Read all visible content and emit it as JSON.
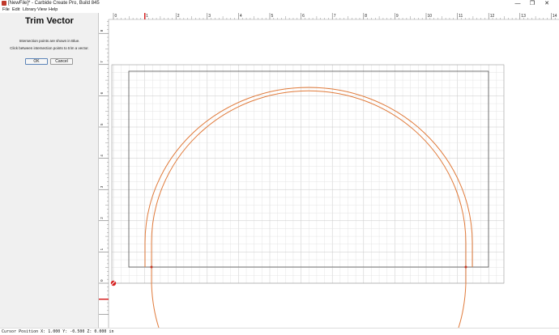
{
  "window": {
    "title": "[NewFile]* - Carbide Create Pro, Build 845",
    "minimize_glyph": "—",
    "maximize_glyph": "❐",
    "close_glyph": "✕"
  },
  "menu": [
    "File",
    "Edit",
    "Library",
    "View",
    "Help"
  ],
  "panel": {
    "title": "Trim Vector",
    "line1": "Intersection points are shown in Blue.",
    "line2": "Click between intersection points to trim a vector.",
    "ok_label": "OK",
    "cancel_label": "Cancel"
  },
  "ruler": {
    "x_ticks": [
      "0",
      "1",
      "2",
      "3",
      "4",
      "5",
      "6",
      "7",
      "8",
      "9",
      "10",
      "11",
      "12",
      "13",
      "14"
    ],
    "y_ticks": [
      "0",
      "1",
      "2",
      "3",
      "4",
      "5",
      "6",
      "7",
      "8"
    ]
  },
  "status": {
    "text": "Cursor Position X: 1.000 Y: -0.500 Z: 0.000 in"
  },
  "colors": {
    "vector": "#e07a3a",
    "grid_minor": "#e4e4e4",
    "grid_major": "#c9c9c9",
    "stock_border": "#555555",
    "origin_marker": "#d62020"
  }
}
